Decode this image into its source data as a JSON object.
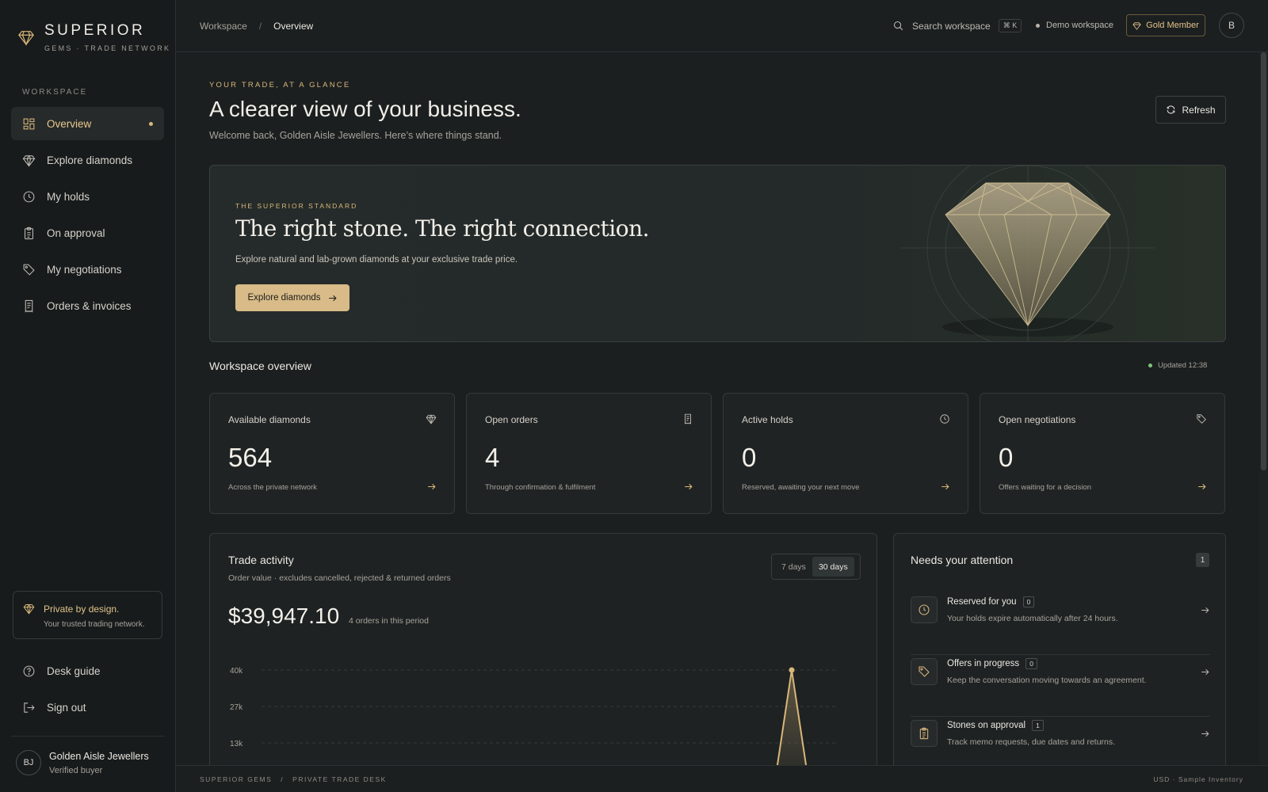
{
  "brand": {
    "name": "SUPERIOR",
    "tagline": "GEMS · TRADE NETWORK"
  },
  "sidebar": {
    "section_label": "WORKSPACE",
    "items": [
      {
        "label": "Overview",
        "icon": "grid-icon",
        "active": true
      },
      {
        "label": "Explore diamonds",
        "icon": "diamond-icon"
      },
      {
        "label": "My holds",
        "icon": "clock-icon"
      },
      {
        "label": "On approval",
        "icon": "clipboard-icon"
      },
      {
        "label": "My negotiations",
        "icon": "tag-icon"
      },
      {
        "label": "Orders & invoices",
        "icon": "receipt-icon"
      }
    ],
    "private": {
      "title": "Private by design.",
      "subtitle": "Your trusted trading network."
    },
    "bottom": [
      {
        "label": "Desk guide",
        "icon": "help-circle-icon"
      },
      {
        "label": "Sign out",
        "icon": "sign-out-icon"
      }
    ],
    "user": {
      "initials": "BJ",
      "name": "Golden Aisle Jewellers",
      "role": "Verified buyer"
    }
  },
  "topbar": {
    "breadcrumb": [
      "Workspace",
      "Overview"
    ],
    "breadcrumb_sep": "/",
    "search_label": "Search workspace",
    "search_shortcut": "⌘ K",
    "workspace_label": "Demo workspace",
    "membership": "Gold Member",
    "avatar_initial": "B"
  },
  "header": {
    "eyebrow": "YOUR TRADE, AT A GLANCE",
    "title": "A clearer view of your business.",
    "subtitle": "Welcome back, Golden Aisle Jewellers. Here’s where things stand.",
    "refresh_label": "Refresh"
  },
  "hero": {
    "eyebrow": "THE SUPERIOR STANDARD",
    "title": "The right stone. The right connection.",
    "subtitle": "Explore natural and lab-grown diamonds at your exclusive trade price.",
    "cta": "Explore diamonds"
  },
  "overview": {
    "title": "Workspace overview",
    "updated": "Updated 12:38",
    "stats": [
      {
        "label": "Available diamonds",
        "value": "564",
        "note": "Across the private network",
        "icon": "diamond-icon"
      },
      {
        "label": "Open orders",
        "value": "4",
        "note": "Through confirmation & fulfilment",
        "icon": "receipt-icon"
      },
      {
        "label": "Active holds",
        "value": "0",
        "note": "Reserved, awaiting your next move",
        "icon": "clock-icon"
      },
      {
        "label": "Open negotiations",
        "value": "0",
        "note": "Offers waiting for a decision",
        "icon": "tag-icon"
      }
    ]
  },
  "trade": {
    "title": "Trade activity",
    "subtitle": "Order value · excludes cancelled, rejected & returned orders",
    "range_options": [
      "7 days",
      "30 days"
    ],
    "range_selected": "30 days",
    "total": "$39,947.10",
    "total_note": "4 orders in this period"
  },
  "chart_data": {
    "type": "area",
    "y_ticks": [
      "40k",
      "27k",
      "13k"
    ],
    "ylim": [
      0,
      40000
    ],
    "peak_value": 40000,
    "accent": "#d9b779"
  },
  "attention": {
    "title": "Needs your attention",
    "badge": "1",
    "items": [
      {
        "title": "Reserved for you",
        "count": "0",
        "desc": "Your holds expire automatically after 24 hours.",
        "icon": "clock-icon"
      },
      {
        "title": "Offers in progress",
        "count": "0",
        "desc": "Keep the conversation moving towards an agreement.",
        "icon": "tag-icon"
      },
      {
        "title": "Stones on approval",
        "count": "1",
        "desc": "Track memo requests, due dates and returns.",
        "icon": "clipboard-icon"
      }
    ]
  },
  "footer": {
    "left": [
      "SUPERIOR GEMS",
      "PRIVATE TRADE DESK"
    ],
    "sep": "/",
    "right": "USD · Sample Inventory"
  },
  "colors": {
    "accent": "#d9b779",
    "background": "#1b1f20",
    "sidebar": "#171b1c",
    "status_live": "#7dc47d"
  }
}
